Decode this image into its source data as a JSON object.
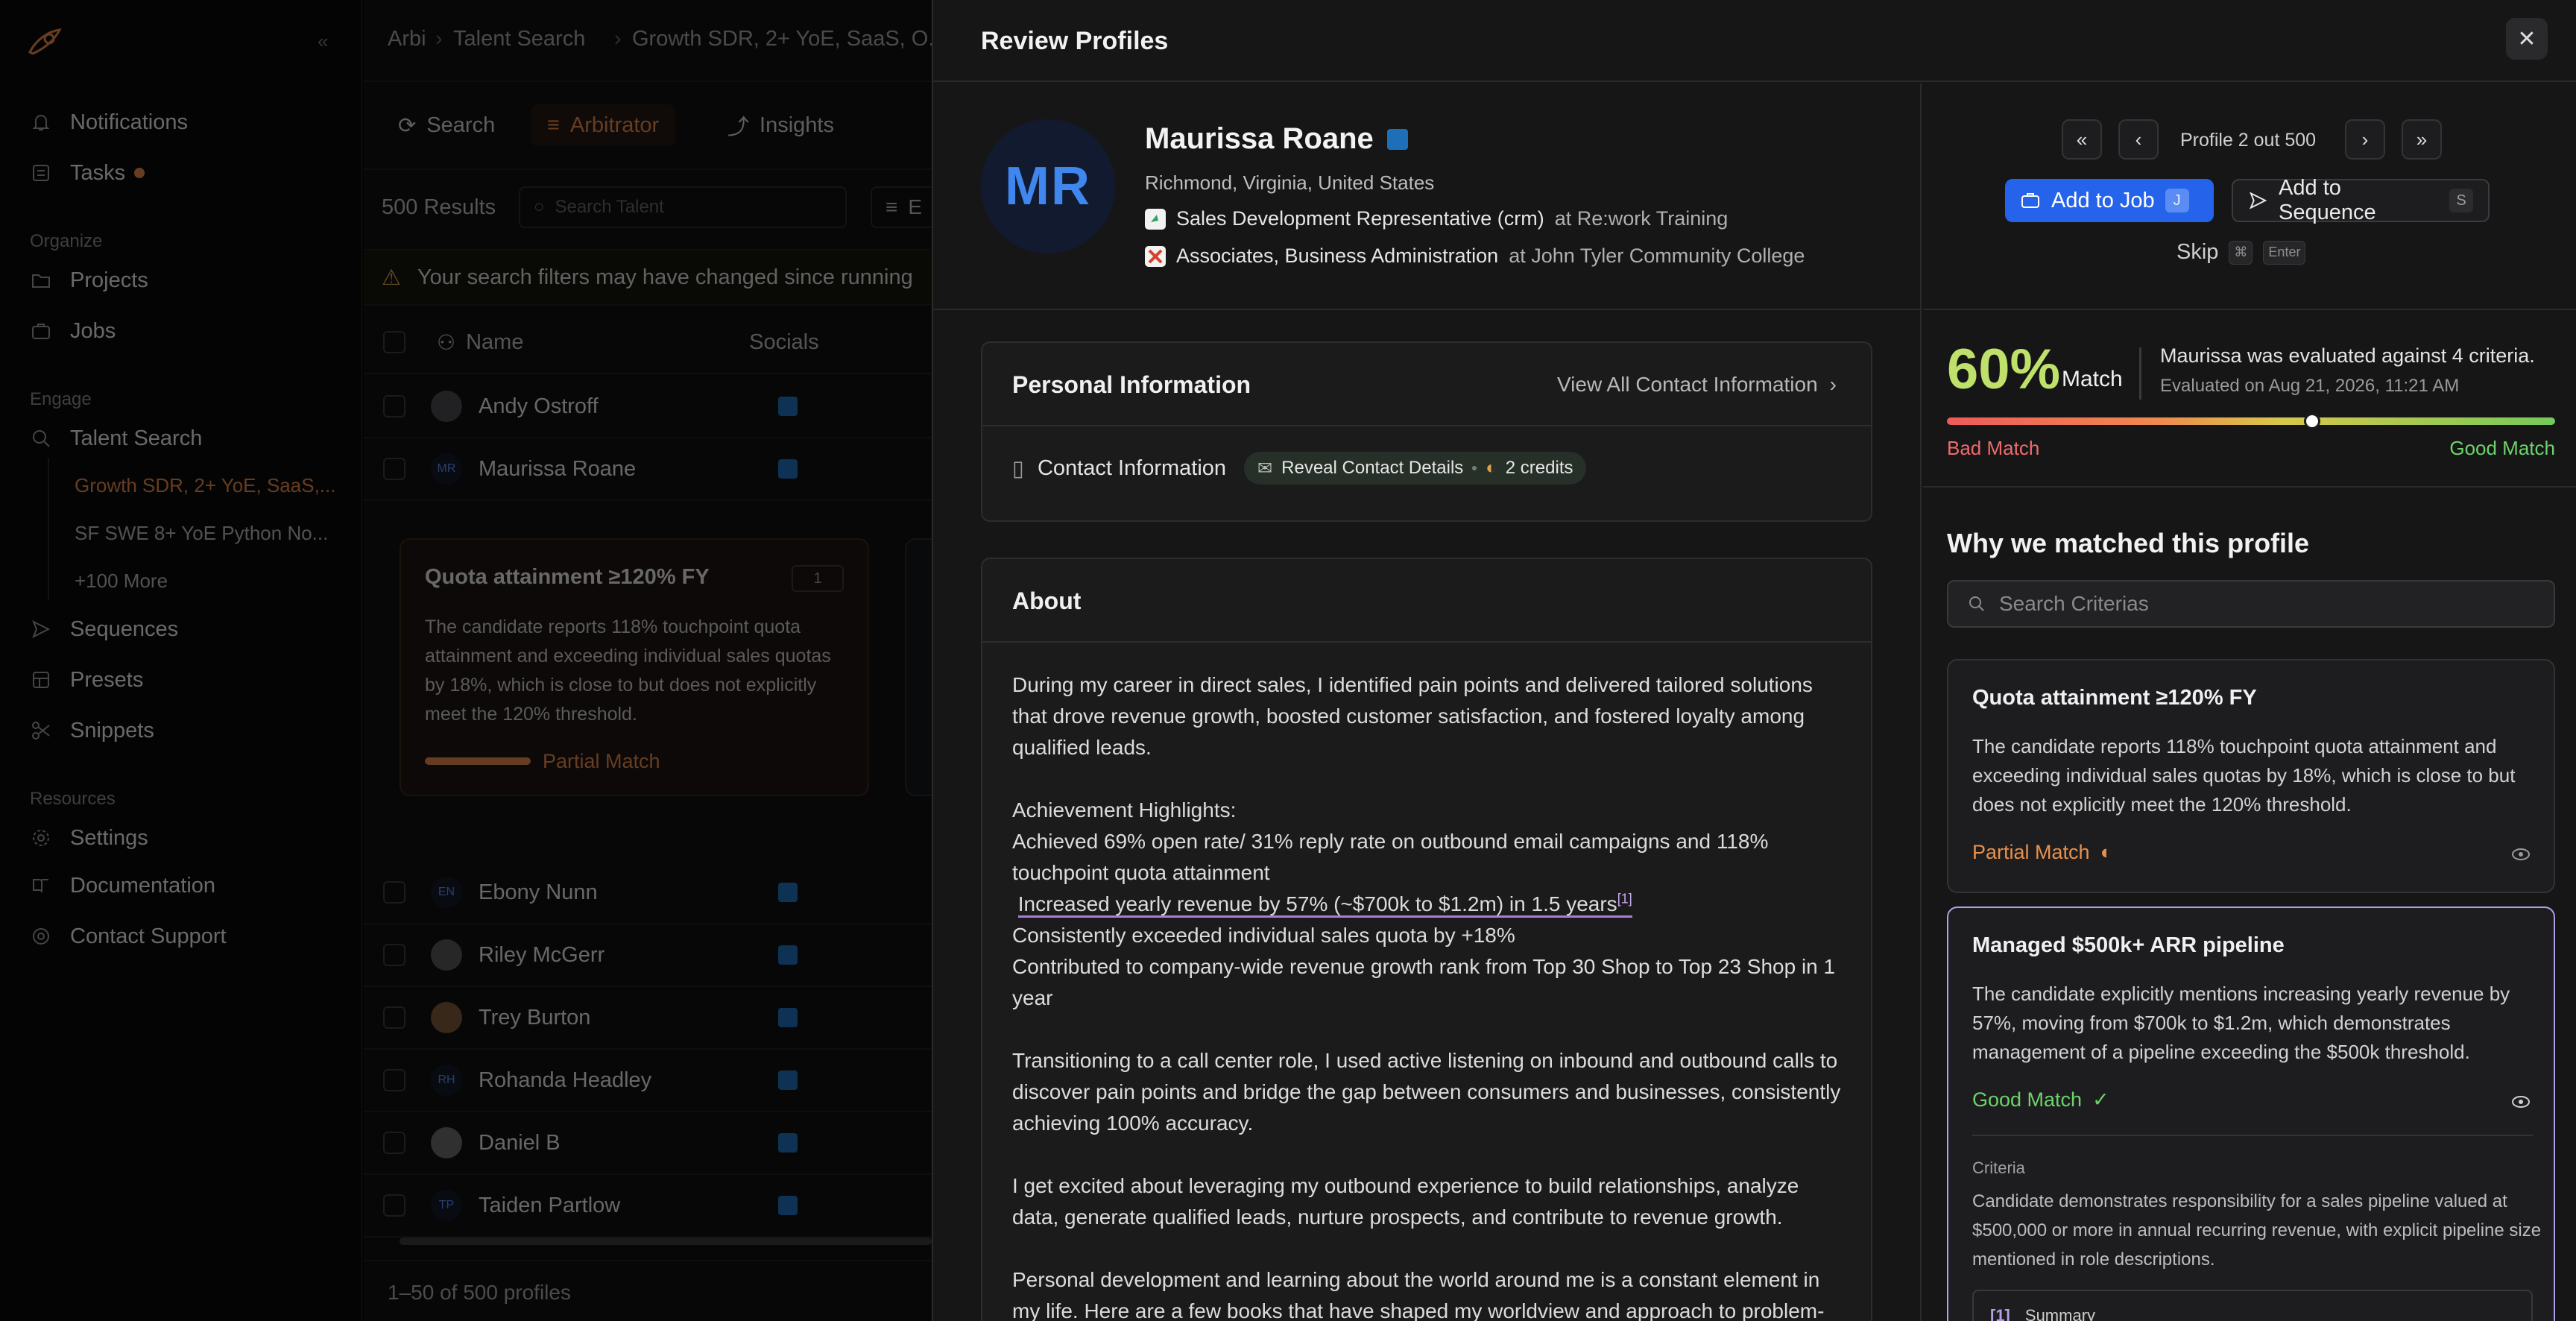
{
  "colors": {
    "accent_orange": "#e3874b",
    "primary_blue": "#2563eb",
    "good": "#6cd36c",
    "bad": "#ef6b6b",
    "partial": "#e8904c",
    "match_pct": "#bfe06a"
  },
  "sidebar": {
    "top": [
      {
        "label": "Notifications",
        "icon": "bell-icon"
      },
      {
        "label": "Tasks",
        "icon": "tasks-icon"
      }
    ],
    "organize_title": "Organize",
    "organize": [
      {
        "label": "Projects",
        "icon": "folder-icon"
      },
      {
        "label": "Jobs",
        "icon": "briefcase-icon"
      }
    ],
    "engage_title": "Engage",
    "talent_search": "Talent Search",
    "talent_sub": [
      "Growth SDR, 2+ YoE, SaaS,...",
      "SF SWE 8+ YoE Python No...",
      "+100 More"
    ],
    "engage": [
      {
        "label": "Sequences",
        "icon": "send-icon"
      },
      {
        "label": "Presets",
        "icon": "grid-icon"
      },
      {
        "label": "Snippets",
        "icon": "scissors-icon"
      }
    ],
    "resources_title": "Resources",
    "resources": [
      {
        "label": "Settings",
        "icon": "gear-icon"
      },
      {
        "label": "Documentation",
        "icon": "book-icon"
      },
      {
        "label": "Contact Support",
        "icon": "support-icon"
      }
    ]
  },
  "main": {
    "breadcrumb": [
      "Arbi",
      "Talent Search",
      "Growth SDR, 2+ YoE, SaaS, O..."
    ],
    "tabs": [
      "Search",
      "Arbitrator",
      "Insights"
    ],
    "results": "500 Results",
    "search_placeholder": "Search Talent",
    "filter_partial": "E",
    "warning": "Your search filters may have changed since running",
    "col_name": "Name",
    "col_socials": "Socials",
    "rows_top": [
      {
        "name": "Andy Ostroff",
        "initials": ""
      },
      {
        "name": "Maurissa Roane",
        "initials": "MR"
      }
    ],
    "expanded_card": {
      "title": "Quota attainment ≥120% FY",
      "badge": "1",
      "text": "The candidate reports 118% touchpoint quota attainment and exceeding individual sales quotas by 18%, which is close to but does not explicitly meet the 120% threshold.",
      "status": "Partial Match"
    },
    "rows_bottom": [
      {
        "name": "Ebony Nunn",
        "initials": "EN"
      },
      {
        "name": "Riley McGerr",
        "initials": ""
      },
      {
        "name": "Trey Burton",
        "initials": ""
      },
      {
        "name": "Rohanda Headley",
        "initials": "RH"
      },
      {
        "name": "Daniel B",
        "initials": ""
      },
      {
        "name": "Taiden Partlow",
        "initials": "TP"
      }
    ],
    "pagination": "1–50 of 500 profiles"
  },
  "modal": {
    "title": "Review Profiles",
    "profile": {
      "initials": "MR",
      "name": "Maurissa Roane",
      "location": "Richmond, Virginia, United States",
      "job_title": "Sales Development Representative (crm)",
      "job_at": "at Re:work Training",
      "edu_title": "Associates, Business Administration",
      "edu_at": "at John Tyler Community College"
    },
    "personal_info": {
      "title": "Personal Information",
      "view_all": "View All Contact Information",
      "contact_label": "Contact Information",
      "reveal": "Reveal Contact Details",
      "credits": "2 credits"
    },
    "about": {
      "title": "About",
      "p1": "During my career in direct sales, I identified pain points and delivered tailored solutions that drove revenue growth, boosted customer satisfaction, and fostered loyalty among qualified leads.",
      "highlights_title": "Achievement Highlights:",
      "h1": " Achieved 69% open rate/ 31% reply rate on outbound email campaigns and 118% touchpoint quota attainment",
      "h2": "Increased yearly revenue by 57% (~$700k to $1.2m) in 1.5 years",
      "h2_ref": "[1]",
      "h3": " Consistently exceeded individual sales quota by +18%",
      "h4": " Contributed to company-wide revenue growth rank from Top 30 Shop to Top 23 Shop in 1 year",
      "p2": " Transitioning to a call center role, I used active listening on inbound and outbound calls to discover pain points and bridge the gap between consumers and businesses, consistently achieving 100% accuracy.",
      "p3": " I get excited about leveraging my outbound experience to build relationships, analyze data, generate qualified leads, nurture prospects, and contribute to revenue growth.",
      "p4": "Personal development and learning about the world around me is a constant element in my life. Here are a few books that have shaped my worldview and approach to problem-"
    },
    "nav": {
      "first": "«",
      "prev": "‹",
      "count": "Profile 2 out 500",
      "next": "›",
      "last": "»",
      "add_job": "Add to Job",
      "add_job_key": "J",
      "add_seq": "Add to Sequence",
      "add_seq_key": "S",
      "skip": "Skip",
      "skip_key1": "⌘",
      "skip_key2": "Enter"
    },
    "match": {
      "percent": "60%",
      "word": "Match",
      "value": 0.6,
      "desc": "Maurissa was evaluated against 4 criteria.",
      "date": "Evaluated on Aug 21, 2026, 11:21 AM",
      "bad": "Bad Match",
      "good": "Good Match"
    },
    "why": {
      "title": "Why we matched this profile",
      "search_placeholder": "Search Criterias",
      "criteria": [
        {
          "title": "Quota attainment ≥120% FY",
          "text": "The candidate reports 118% touchpoint quota attainment and exceeding individual sales quotas by 18%, which is close to but does not explicitly meet the 120% threshold.",
          "status": "Partial Match"
        },
        {
          "title": "Managed $500k+ ARR pipeline",
          "text": "The candidate explicitly mentions increasing yearly revenue by 57%, moving from $700k to $1.2m, which demonstrates management of a pipeline exceeding the $500k threshold.",
          "status": "Good Match",
          "criteria_label": "Criteria",
          "criteria_desc": "Candidate demonstrates responsibility for a sales pipeline valued at $500,000 or more in annual recurring revenue, with explicit pipeline size mentioned in role descriptions.",
          "summary_ref": "[1]",
          "summary_label": "Summary"
        }
      ]
    }
  }
}
